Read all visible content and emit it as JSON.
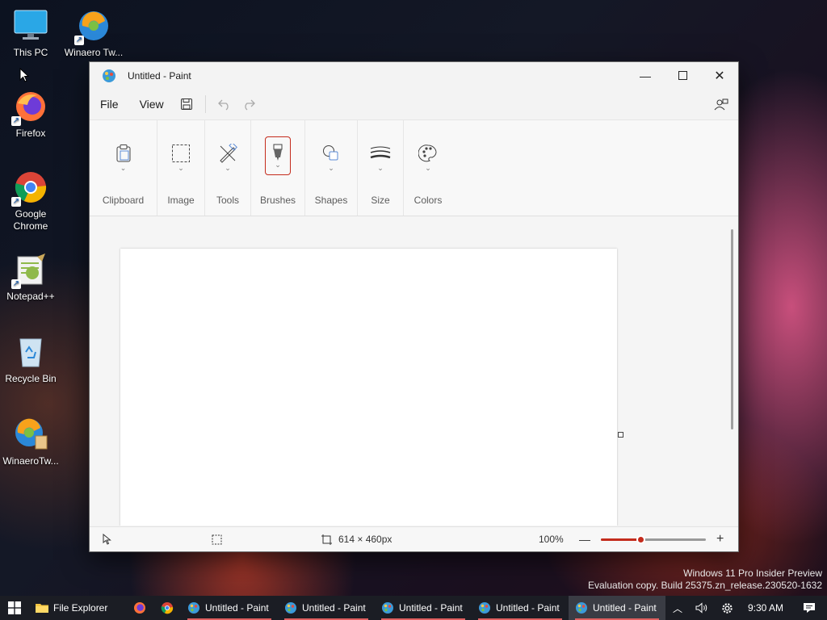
{
  "desktop": {
    "icons": [
      {
        "label": "This PC"
      },
      {
        "label": "Winaero Tw..."
      },
      {
        "label": "Firefox"
      },
      {
        "label": "Google Chrome"
      },
      {
        "label": "Notepad++"
      },
      {
        "label": "Recycle Bin"
      },
      {
        "label": "WinaeroTw..."
      }
    ]
  },
  "window": {
    "title": "Untitled - Paint",
    "menu": {
      "file": "File",
      "view": "View"
    },
    "ribbon": {
      "groups": [
        {
          "label": "Clipboard",
          "icon": "clipboard-icon"
        },
        {
          "label": "Image",
          "icon": "selection-icon"
        },
        {
          "label": "Tools",
          "icon": "tools-icon"
        },
        {
          "label": "Brushes",
          "icon": "brush-icon"
        },
        {
          "label": "Shapes",
          "icon": "shapes-icon"
        },
        {
          "label": "Size",
          "icon": "size-icon"
        },
        {
          "label": "Colors",
          "icon": "palette-icon"
        }
      ],
      "selected_group": "Brushes"
    },
    "status": {
      "canvas_size": "614 × 460px",
      "zoom": "100%",
      "zoom_fraction": 0.38
    }
  },
  "watermark": {
    "line1": "Windows 11 Pro Insider Preview",
    "line2": "Evaluation copy. Build 25375.zn_release.230520-1632"
  },
  "taskbar": {
    "file_explorer": "File Explorer",
    "paint_instances": [
      "Untitled - Paint",
      "Untitled - Paint",
      "Untitled - Paint",
      "Untitled - Paint",
      "Untitled - Paint"
    ],
    "clock": "9:30 AM"
  },
  "colors": {
    "accent": "#c42b1c"
  }
}
